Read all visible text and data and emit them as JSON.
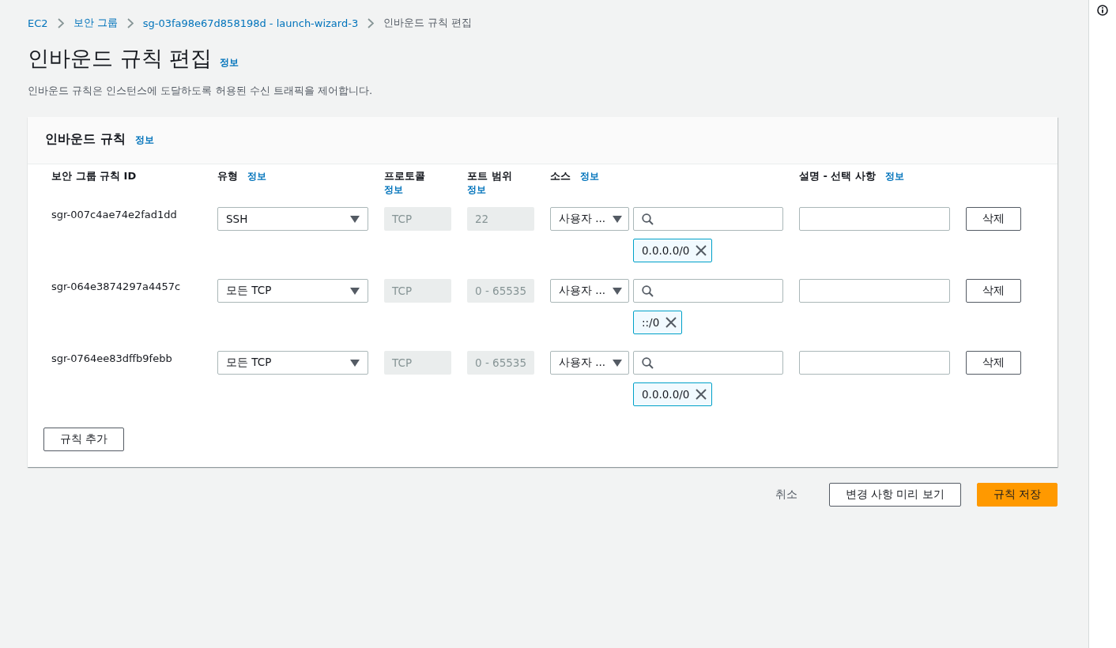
{
  "breadcrumbs": [
    {
      "label": "EC2",
      "link": true
    },
    {
      "label": "보안 그룹",
      "link": true
    },
    {
      "label": "sg-03fa98e67d858198d - launch-wizard-3",
      "link": true
    },
    {
      "label": "인바운드 규칙 편집",
      "link": false
    }
  ],
  "page": {
    "title": "인바운드 규칙 편집",
    "info": "정보",
    "description": "인바운드 규칙은 인스턴스에 도달하도록 허용된 수신 트래픽을 제어합니다."
  },
  "panel": {
    "title": "인바운드 규칙",
    "info": "정보",
    "columns": [
      {
        "label": "보안 그룹 규칙 ID"
      },
      {
        "label": "유형",
        "info": "정보"
      },
      {
        "label": "프로토콜",
        "info": "정보"
      },
      {
        "label": "포트 범위",
        "info": "정보"
      },
      {
        "label": "소스",
        "info": "정보"
      },
      {
        "label": "설명 - 선택 사항",
        "info": "정보"
      }
    ],
    "rows": [
      {
        "id": "sgr-007c4ae74e2fad1dd",
        "type": "SSH",
        "protocol": "TCP",
        "port": "22",
        "source_type": "사용자 ...",
        "tags": [
          "0.0.0.0/0"
        ],
        "delete": "삭제"
      },
      {
        "id": "sgr-064e3874297a4457c",
        "type": "모든 TCP",
        "protocol": "TCP",
        "port": "0 - 65535",
        "source_type": "사용자 ...",
        "tags": [
          "::/0"
        ],
        "delete": "삭제"
      },
      {
        "id": "sgr-0764ee83dffb9febb",
        "type": "모든 TCP",
        "protocol": "TCP",
        "port": "0 - 65535",
        "source_type": "사용자 ...",
        "tags": [
          "0.0.0.0/0"
        ],
        "delete": "삭제"
      }
    ],
    "add_button": "규칙 추가"
  },
  "actions": [
    {
      "label": "취소",
      "kind": "link"
    },
    {
      "label": "변경 사항 미리 보기",
      "kind": "normal"
    },
    {
      "label": "규칙 저장",
      "kind": "primary"
    }
  ]
}
